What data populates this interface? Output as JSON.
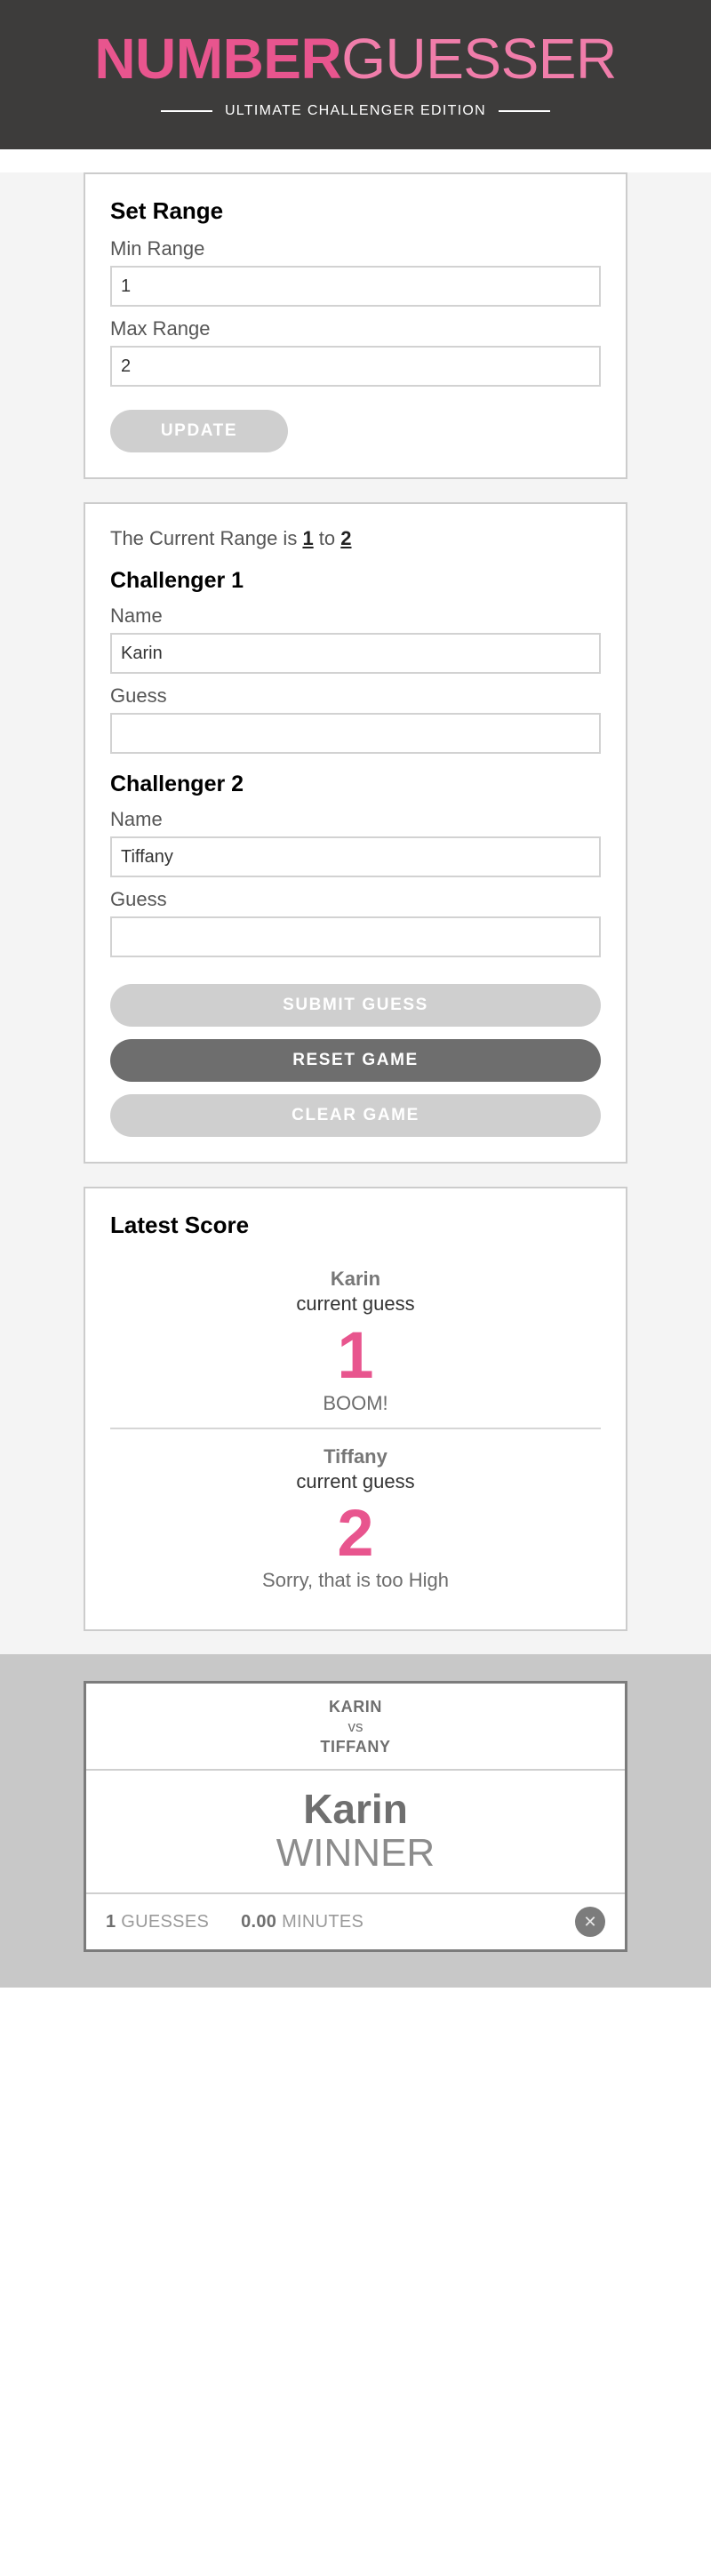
{
  "header": {
    "logo_bold": "NUMBER",
    "logo_thin": "GUESSER",
    "tagline": "ULTIMATE CHALLENGER EDITION"
  },
  "set_range": {
    "title": "Set Range",
    "min_label": "Min Range",
    "min_value": "1",
    "max_label": "Max Range",
    "max_value": "2",
    "update_label": "UPDATE"
  },
  "game": {
    "range_prefix": "The Current Range is ",
    "range_min": "1",
    "range_mid": " to ",
    "range_max": "2",
    "challenger1": {
      "heading": "Challenger 1",
      "name_label": "Name",
      "name_value": "Karin",
      "guess_label": "Guess",
      "guess_value": ""
    },
    "challenger2": {
      "heading": "Challenger 2",
      "name_label": "Name",
      "name_value": "Tiffany",
      "guess_label": "Guess",
      "guess_value": ""
    },
    "submit_label": "SUBMIT GUESS",
    "reset_label": "RESET GAME",
    "clear_label": "CLEAR GAME"
  },
  "score": {
    "title": "Latest Score",
    "entries": [
      {
        "name": "Karin",
        "sub": "current guess",
        "value": "1",
        "message": "BOOM!"
      },
      {
        "name": "Tiffany",
        "sub": "current guess",
        "value": "2",
        "message": "Sorry, that is too High"
      }
    ]
  },
  "winner": {
    "player_one": "KARIN",
    "vs": "vs",
    "player_two": "TIFFANY",
    "name": "Karin",
    "label": "WINNER",
    "guesses_value": "1",
    "guesses_label": " GUESSES",
    "minutes_value": "0.00",
    "minutes_label": " MINUTES",
    "close_icon": "✕"
  },
  "colors": {
    "accent_pink": "#e8558e",
    "header_dark": "#3d3c3b",
    "button_active": "#6e6e6e",
    "button_disabled": "#cfcfcf"
  }
}
